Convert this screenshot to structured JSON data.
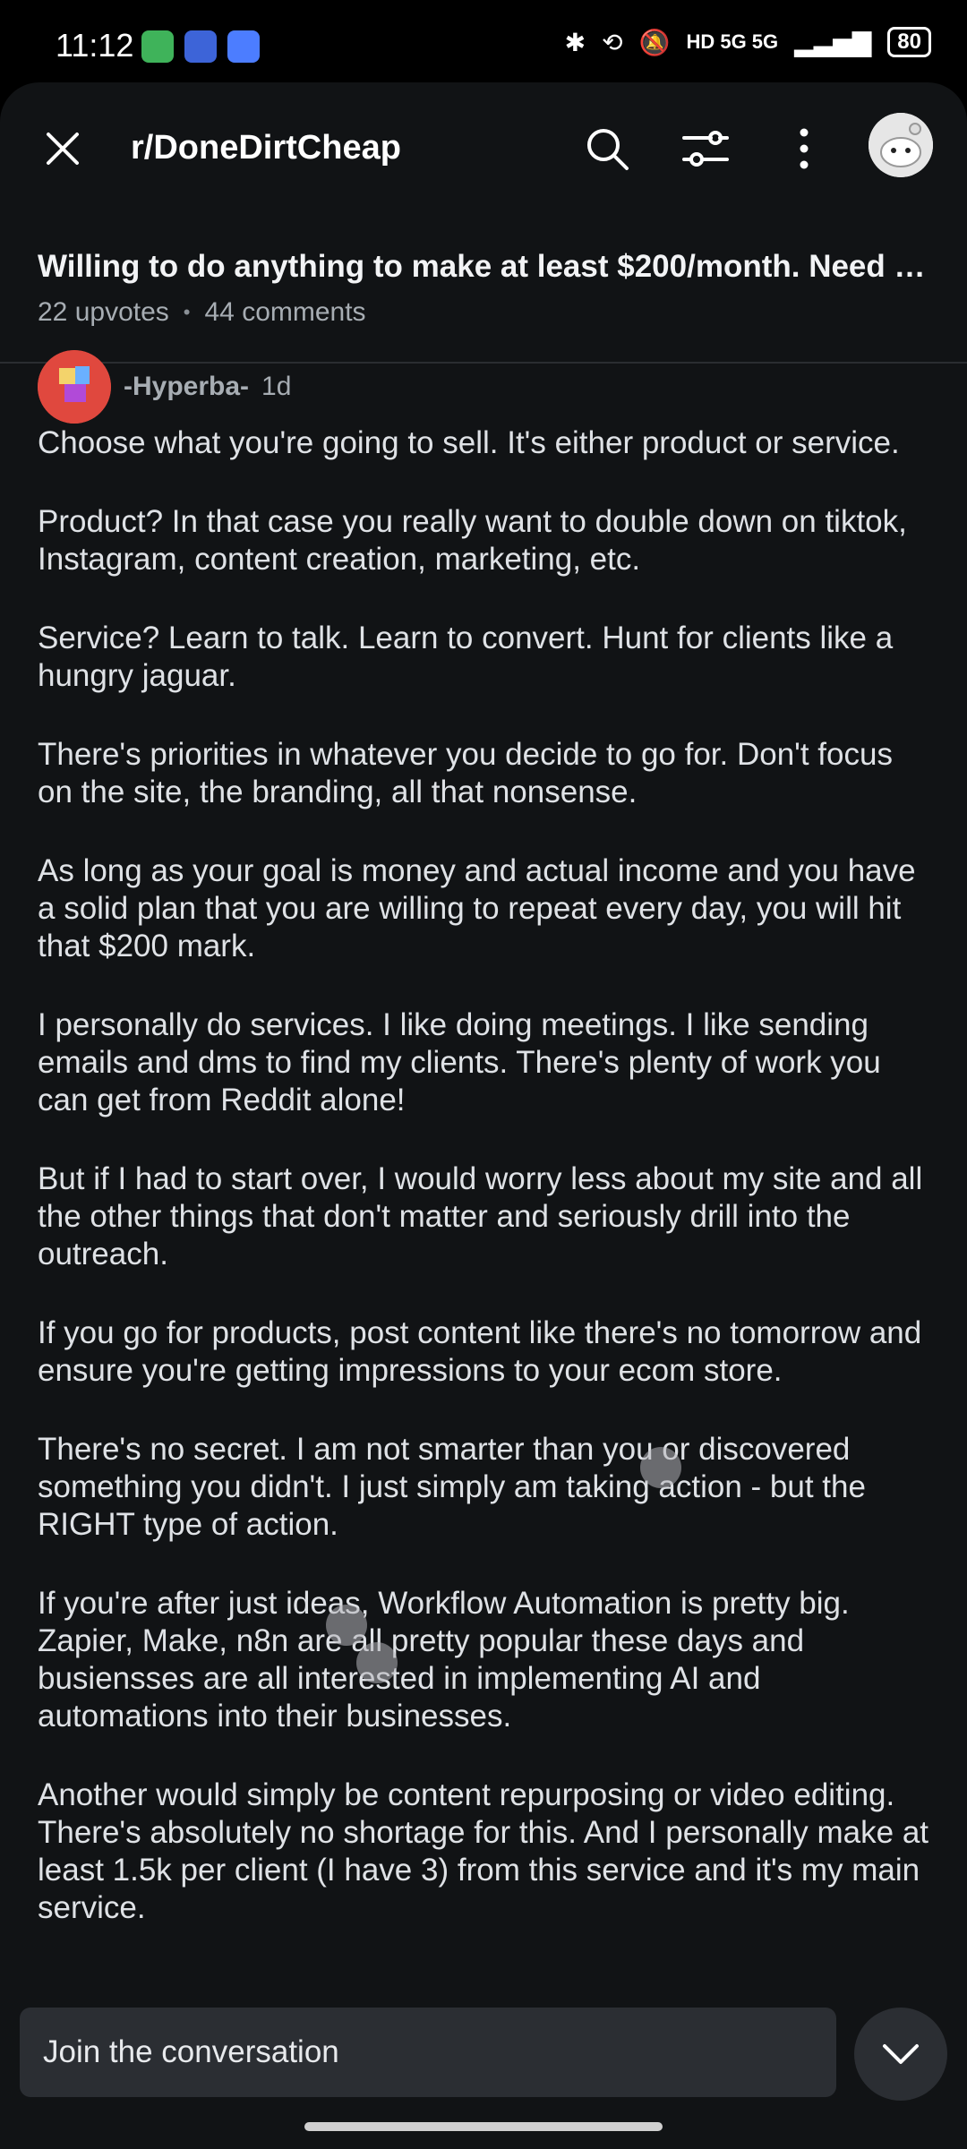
{
  "status_bar": {
    "time": "11:12",
    "network_label": "HD 5G 5G",
    "battery": "80"
  },
  "header": {
    "subreddit": "r/DoneDirtCheap",
    "actions": [
      "close-icon",
      "search-icon",
      "filter-icon",
      "more-vert-icon",
      "avatar"
    ]
  },
  "post": {
    "title": "Willing to do anything to make at least $200/month. Need re...",
    "upvotes": "22 upvotes",
    "separator": "•",
    "comments": "44 comments"
  },
  "comment": {
    "username": "-Hyperba-",
    "age": "1d",
    "paragraphs": [
      "Choose what you're going to sell. It's either product or service.",
      "Product? In that case you really want to double down on tiktok, Instagram, content creation, marketing, etc.",
      "Service? Learn to talk. Learn to convert. Hunt for clients like a hungry jaguar.",
      "There's priorities in whatever you decide to go for. Don't focus on the site, the branding, all that nonsense.",
      "As long as your goal is money and actual income and you have a solid plan that you are willing to repeat every day, you will hit that $200 mark.",
      "I personally do services. I like doing meetings. I like sending emails and dms to find my clients. There's plenty of work you can get from Reddit alone!",
      "But if I had to start over, I would worry less about my site and all the other things that don't matter and seriously drill into the outreach.",
      "If you go for products, post content like there's no tomorrow and ensure you're getting impressions to your ecom store.",
      "There's no secret. I am not smarter than you or discovered something you didn't. I just simply am taking action - but the RIGHT type of action.",
      "If you're after just ideas, Workflow Automation is pretty big. Zapier, Make, n8n are all pretty popular these days and busiensses are all interested in implementing AI and automations into their businesses.",
      "Another would simply be content repurposing or video editing. There's absolutely no shortage for this. And I personally make at least 1.5k per client (I have 3) from this service and it's my main service."
    ]
  },
  "composer": {
    "placeholder": "Join the conversation"
  },
  "colors": {
    "background": "#111315",
    "text": "#dfe2e6",
    "muted": "#a7adb3",
    "avatar_bg": "#e0483e"
  }
}
